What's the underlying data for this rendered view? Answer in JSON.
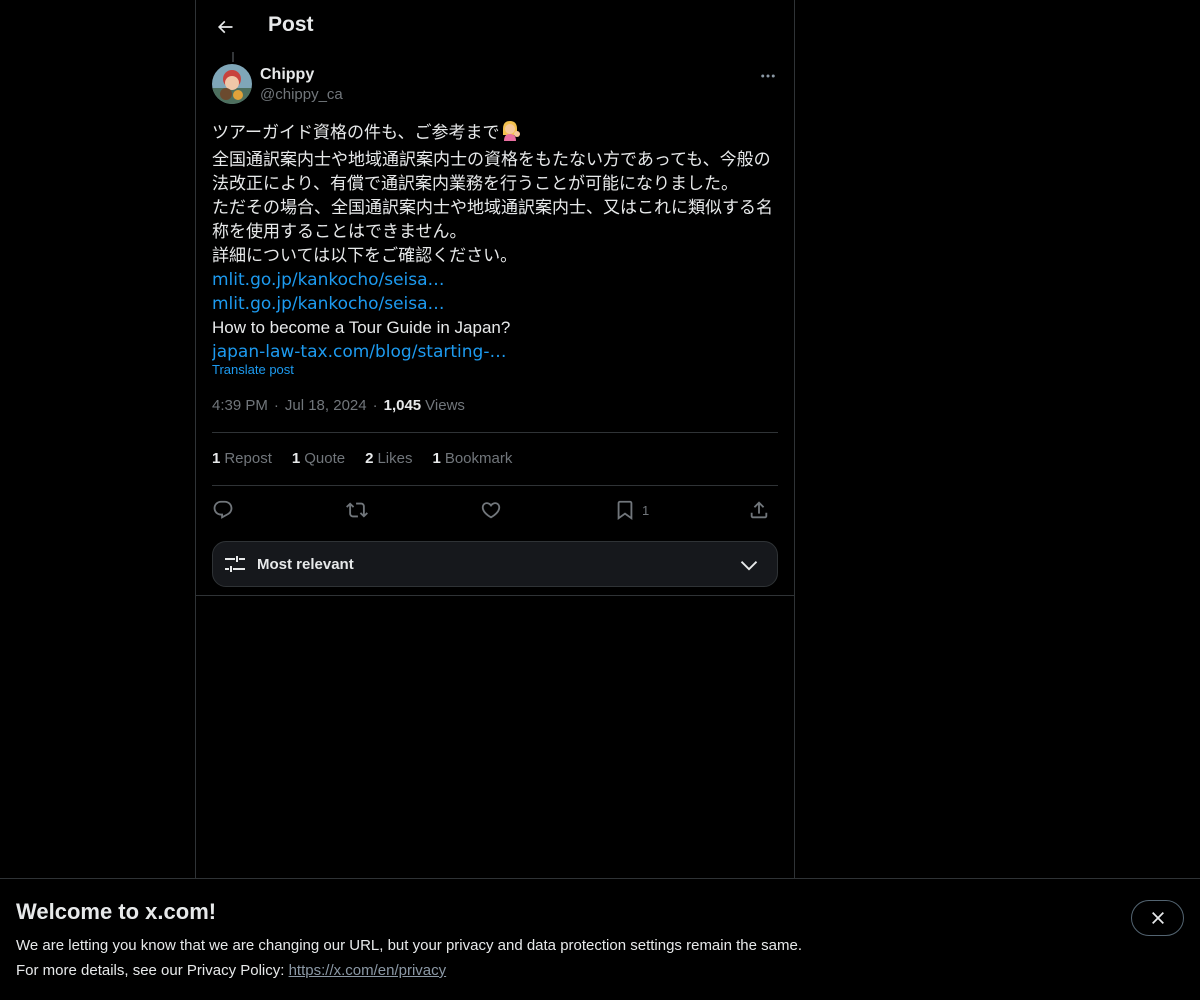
{
  "header": {
    "title": "Post",
    "back_icon": "arrow-left-icon"
  },
  "post": {
    "author": {
      "name": "Chippy",
      "handle": "@chippy_ca"
    },
    "lines": [
      "ツアーガイド資格の件も、ご参考まで",
      "全国通訳案内士や地域通訳案内士の資格をもたない方であっても、今般の",
      "法改正により、有償で通訳案内業務を行うことが可能になりました。",
      "ただその場合、全国通訳案内士や地域通訳案内士、又はこれに類似する名",
      "称を使用することはできません。",
      "詳細については以下をご確認ください。"
    ],
    "links": [
      "mlit.go.jp/kankocho/seisa…",
      "mlit.go.jp/kankocho/seisa…"
    ],
    "english_line": "How to become a Tour Guide in Japan?",
    "link3": "japan-law-tax.com/blog/starting-…",
    "translate": "Translate post",
    "time": "4:39 PM",
    "date": "Jul 18, 2024",
    "views_count": "1,045",
    "views_label": "Views"
  },
  "stats": {
    "reposts": {
      "count": "1",
      "label": "Repost"
    },
    "quotes": {
      "count": "1",
      "label": "Quote"
    },
    "likes": {
      "count": "2",
      "label": "Likes"
    },
    "bookmarks": {
      "count": "1",
      "label": "Bookmark"
    }
  },
  "actions": {
    "reply_icon": "reply-icon",
    "repost_icon": "repost-icon",
    "like_icon": "heart-icon",
    "bookmark_icon": "bookmark-icon",
    "bookmark_count": "1",
    "share_icon": "share-icon"
  },
  "sort": {
    "label": "Most relevant"
  },
  "banner": {
    "title": "Welcome to x.com!",
    "line1": "We are letting you know that we are changing our URL, but your privacy and data protection settings remain the same.",
    "line2_prefix": "For more details, see our Privacy Policy: ",
    "link": "https://x.com/en/privacy"
  },
  "colors": {
    "background": "#000000",
    "text": "#e7e9ea",
    "muted": "#71767b",
    "link": "#1d9bf0",
    "border": "#2f3336"
  }
}
